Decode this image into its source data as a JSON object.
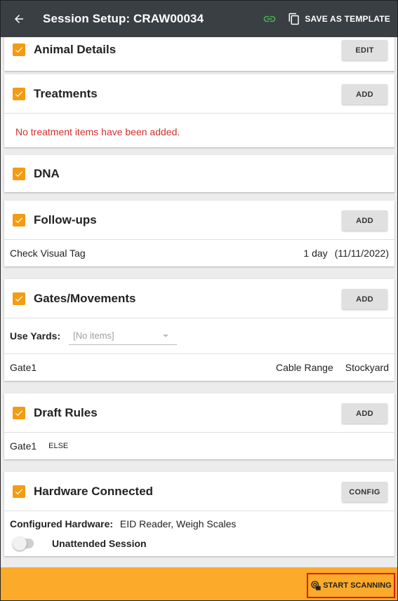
{
  "header": {
    "title": "Session Setup: CRAW00034",
    "save_as_template": "SAVE AS TEMPLATE"
  },
  "sections": {
    "animal_details": {
      "title": "Animal Details",
      "button": "EDIT"
    },
    "treatments": {
      "title": "Treatments",
      "button": "ADD",
      "empty_message": "No treatment items have been added."
    },
    "dna": {
      "title": "DNA"
    },
    "followups": {
      "title": "Follow-ups",
      "button": "ADD",
      "items": [
        {
          "name": "Check Visual Tag",
          "duration": "1 day",
          "date": "(11/11/2022)"
        }
      ]
    },
    "gates": {
      "title": "Gates/Movements",
      "button": "ADD",
      "use_yards_label": "Use Yards:",
      "use_yards_value": "[No items]",
      "items": [
        {
          "gate": "Gate1",
          "from": "Cable Range",
          "to": "Stockyard"
        }
      ]
    },
    "draft_rules": {
      "title": "Draft Rules",
      "button": "ADD",
      "items": [
        {
          "gate": "Gate1",
          "rule": "ELSE"
        }
      ]
    },
    "hardware": {
      "title": "Hardware Connected",
      "button": "CONFIG",
      "configured_label": "Configured Hardware:",
      "configured_value": "EID Reader, Weigh Scales",
      "unattended_label": "Unattended Session"
    }
  },
  "footer": {
    "start_scanning": "START SCANNING"
  },
  "colors": {
    "appbar": "#3a3f44",
    "accent": "#f39c12",
    "footer": "#fbaa2a",
    "link_icon": "#4caf50",
    "error": "#d32f2f"
  }
}
